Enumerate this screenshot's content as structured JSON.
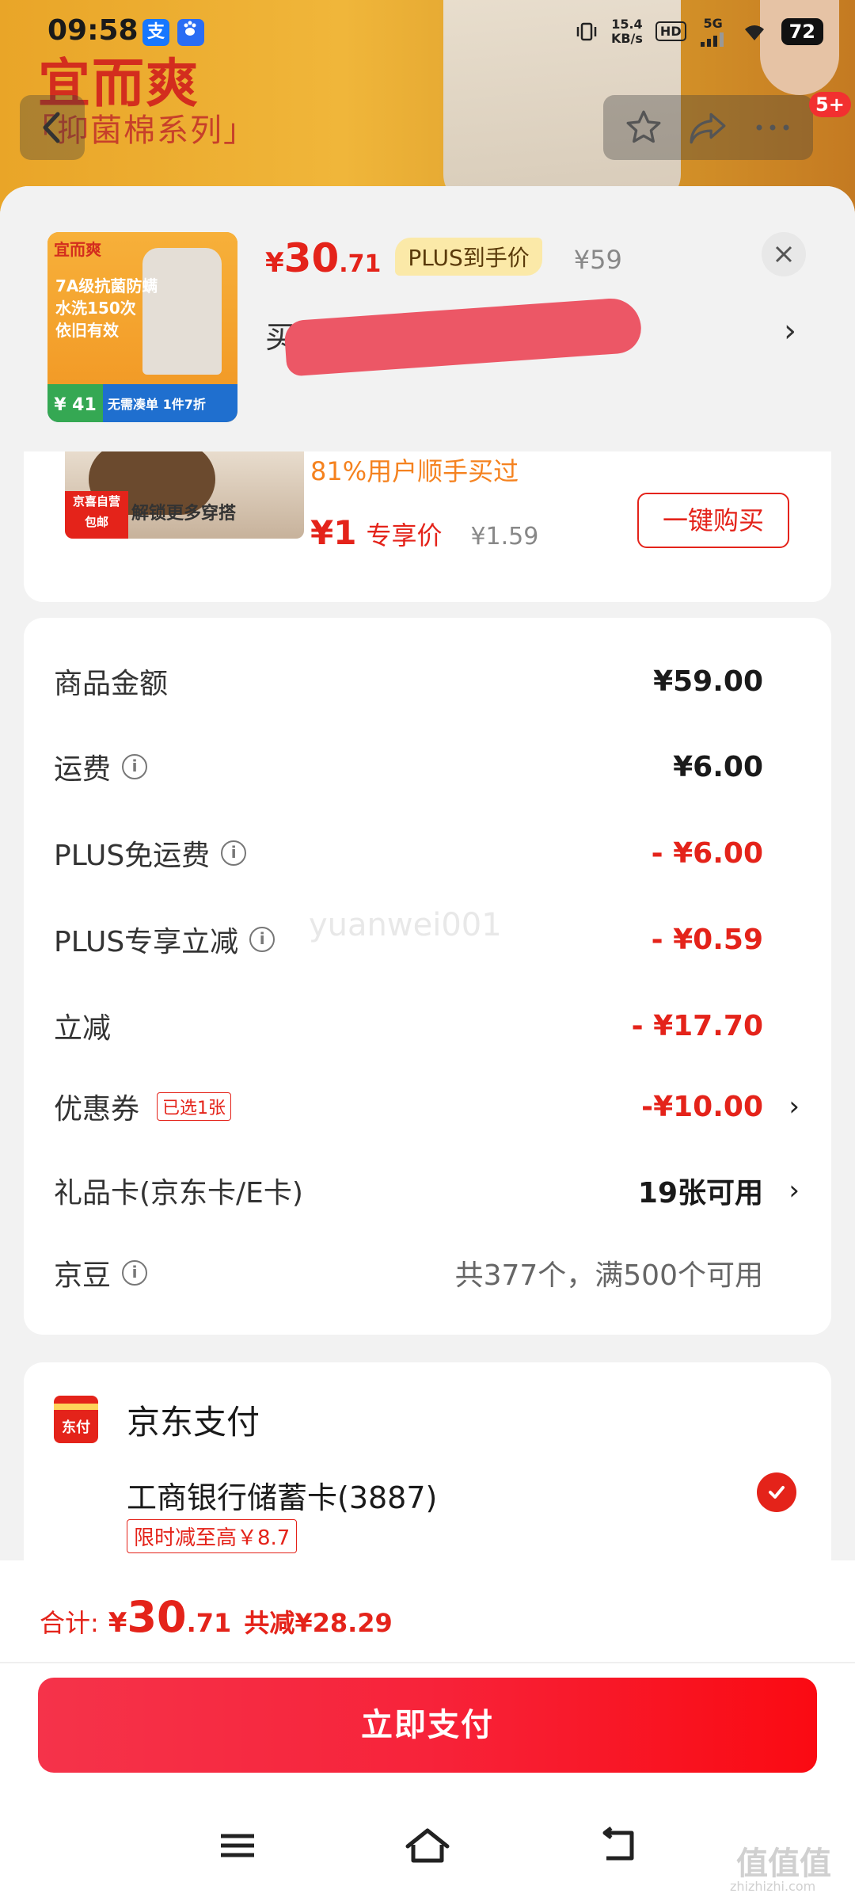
{
  "status_bar": {
    "time": "09:58",
    "speed": "15.4\nKB/s",
    "network": "5G",
    "hd": "HD",
    "battery": "72"
  },
  "header": {
    "brand": "宜而爽",
    "series": "「抑菌棉系列」",
    "badge": "5+"
  },
  "product": {
    "thumb_brand": "宜而爽",
    "thumb_line1": "7A级抗菌防螨",
    "thumb_line2": "水洗150次",
    "thumb_line3": "依旧有效",
    "thumb_price": "¥ 41",
    "thumb_promo": "无需凑单 1件7折",
    "price_symbol": "¥",
    "price_int": "30",
    "price_dec": ".71",
    "plus_tag": "PLUS到手价",
    "original_price": "¥59",
    "title": "买 静、",
    "arrow": "›"
  },
  "upsell": {
    "tag": "京喜自营\n包邮",
    "img_text": "解锁更多穿搭",
    "rate": "81%用户顺手买过",
    "price": "¥1",
    "price_label": "专享价",
    "orig_price": "¥1.59",
    "buy_button": "一键购买"
  },
  "fees": {
    "goods_label": "商品金额",
    "goods_value": "¥59.00",
    "shipping_label": "运费",
    "shipping_value": "¥6.00",
    "plus_free_label": "PLUS免运费",
    "plus_free_value": "- ¥6.00",
    "plus_discount_label": "PLUS专享立减",
    "plus_discount_value": "- ¥0.59",
    "instant_label": "立减",
    "instant_value": "- ¥17.70",
    "coupon_label": "优惠券",
    "coupon_tag": "已选1张",
    "coupon_value": "-¥10.00",
    "giftcard_label": "礼品卡(京东卡/E卡)",
    "giftcard_value": "19张可用",
    "jingdou_label": "京豆",
    "jingdou_value": "共377个，满500个可用",
    "watermark": "yuanwei001"
  },
  "payment": {
    "logo_text": "东付",
    "title": "京东支付",
    "bank": "工商银行储蓄卡(3887)",
    "promo": "限时减至高￥8.7"
  },
  "bottom": {
    "total_label": "合计:",
    "total_symbol": "¥",
    "total_int": "30",
    "total_dec": ".71",
    "total_save": "共减¥28.29",
    "pay_button": "立即支付"
  },
  "watermark_site": {
    "main": "值值值",
    "sub": "zhizhizhi.com"
  },
  "colors": {
    "accent_red": "#e4231a",
    "plus_gold": "#fbe9a8",
    "orange": "#f5821f"
  }
}
